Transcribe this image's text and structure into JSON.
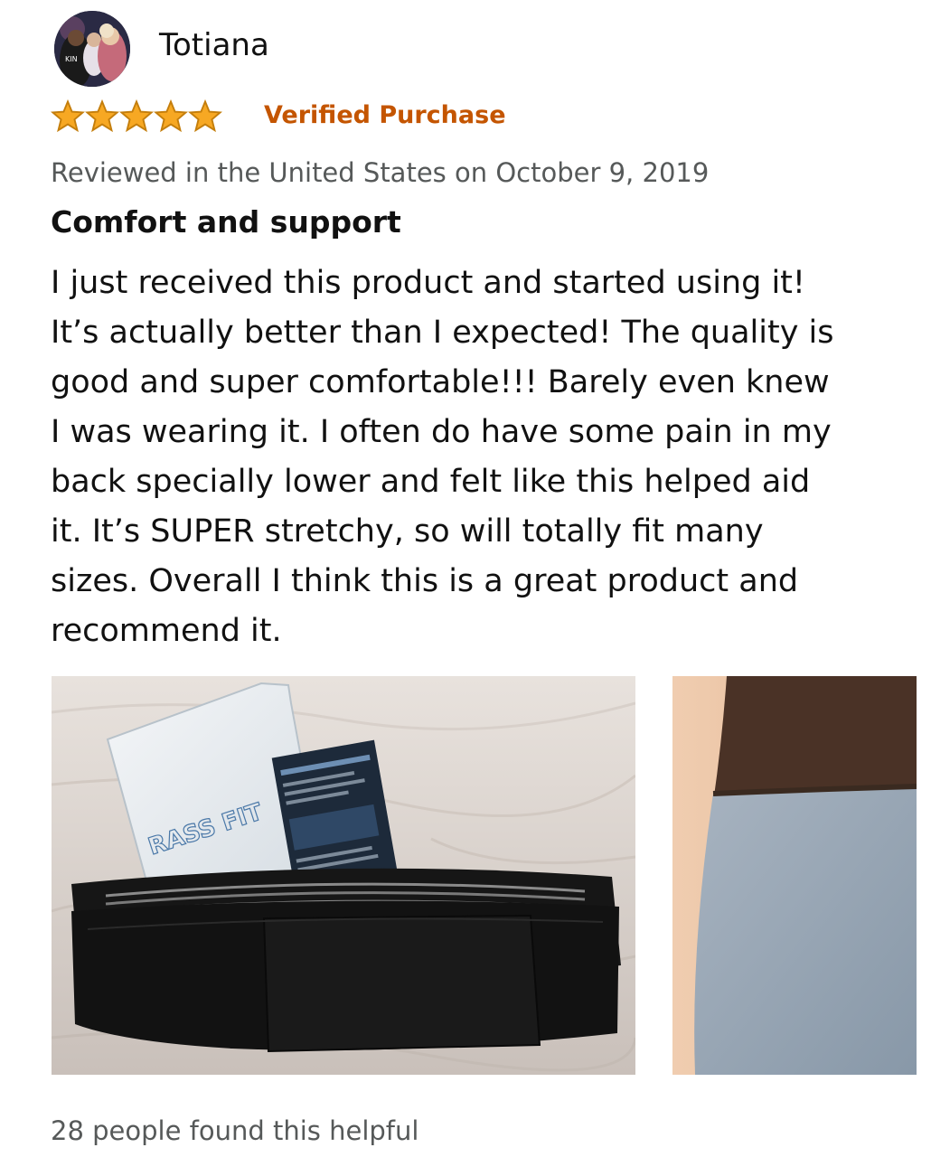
{
  "review": {
    "author": {
      "name": "Totiana",
      "avatar_text": "KIN"
    },
    "rating": {
      "stars": 5,
      "max": 5,
      "star_color": "#f7a823",
      "star_outline": "#c47e0c"
    },
    "verified_label": "Verified Purchase",
    "verified_color": "#c45500",
    "meta": "Reviewed in the United States on October 9, 2019",
    "title": "Comfort and support",
    "body_lines": [
      "I just received this product and started using it!",
      "It’s actually better than I expected! The quality is",
      "good and super comfortable!!! Barely even knew",
      "I was wearing it. I often do have some pain in my",
      "back specially lower and felt like this helped aid",
      "it. It’s SUPER stretchy, so will totally fit many",
      "sizes. Overall I think this is a great product and",
      "recommend it."
    ],
    "photos": [
      {
        "name": "product-photo",
        "brand_text": "RASS FIT"
      },
      {
        "name": "worn-photo"
      }
    ],
    "helpful_text": "28 people found this helpful"
  }
}
